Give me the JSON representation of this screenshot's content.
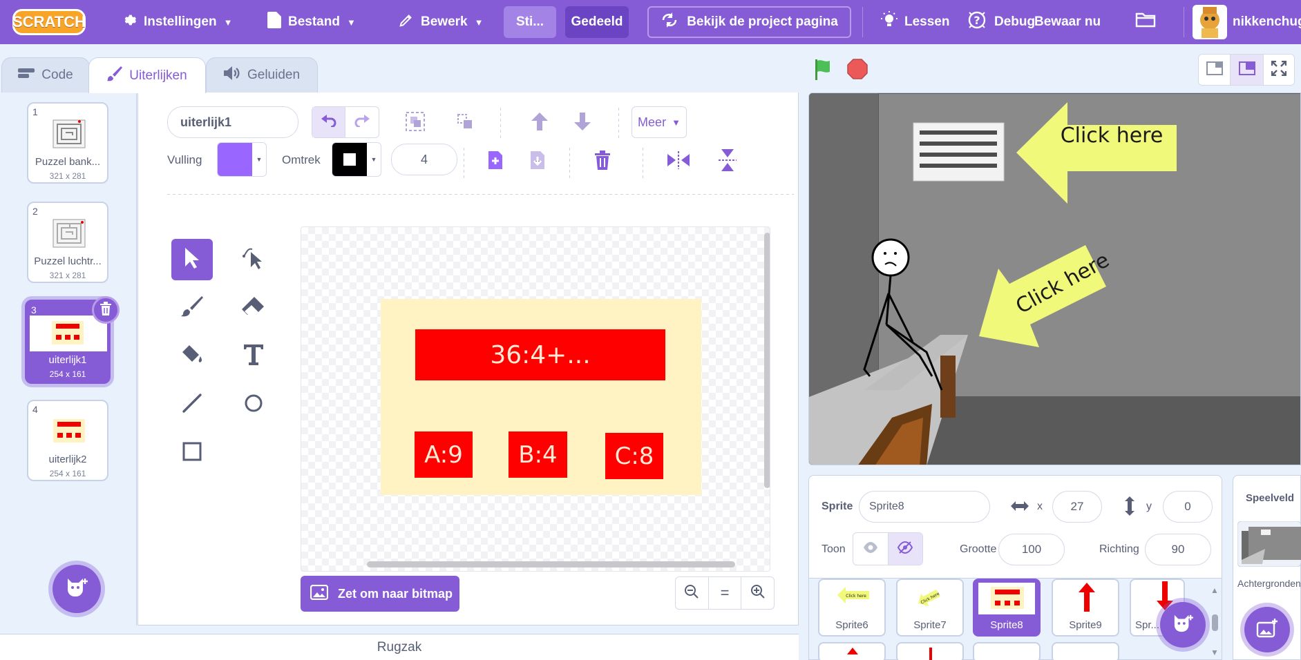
{
  "menubar": {
    "logo": "SCRATCH",
    "settings": "Instellingen",
    "file": "Bestand",
    "edit": "Bewerk",
    "style": "Sti...",
    "shared": "Gedeeld",
    "project_page": "Bekijk de project pagina",
    "lessons": "Lessen",
    "debug": "Debug",
    "save_now": "Bewaar nu",
    "username": "nikkenchug"
  },
  "tabs": {
    "code": "Code",
    "costumes": "Uiterlijken",
    "sounds": "Geluiden"
  },
  "costumes": [
    {
      "num": "1",
      "name": "Puzzel bank...",
      "dims": "321 x 281"
    },
    {
      "num": "2",
      "name": "Puzzel luchtr...",
      "dims": "321 x 281"
    },
    {
      "num": "3",
      "name": "uiterlijk1",
      "dims": "254 x 161"
    },
    {
      "num": "4",
      "name": "uiterlijk2",
      "dims": "254 x 161"
    }
  ],
  "editor": {
    "costume_name": "uiterlijk1",
    "more": "Meer",
    "fill_label": "Vulling",
    "outline_label": "Omtrek",
    "outline_width": "4",
    "fill_color": "#9966ff",
    "outline_color": "#000000",
    "convert_bitmap": "Zet om naar bitmap",
    "zoom_reset": "="
  },
  "canvas": {
    "question": "36:4+...",
    "answers": [
      "A:9",
      "B:4",
      "C:8"
    ]
  },
  "stage": {
    "arrow1": "Click here",
    "arrow2": "Click here"
  },
  "sprite_info": {
    "sprite_label": "Sprite",
    "sprite_name": "Sprite8",
    "x_label": "x",
    "x": "27",
    "y_label": "y",
    "y": "0",
    "show_label": "Toon",
    "size_label": "Grootte",
    "size": "100",
    "direction_label": "Richting",
    "direction": "90"
  },
  "sprites": [
    "Sprite6",
    "Sprite7",
    "Sprite8",
    "Sprite9",
    "Spr..."
  ],
  "sprite_thumb_text": "Click here",
  "stage_panel": {
    "title": "Speelveld",
    "backdrops": "Achtergronden"
  },
  "backpack": "Rugzak"
}
